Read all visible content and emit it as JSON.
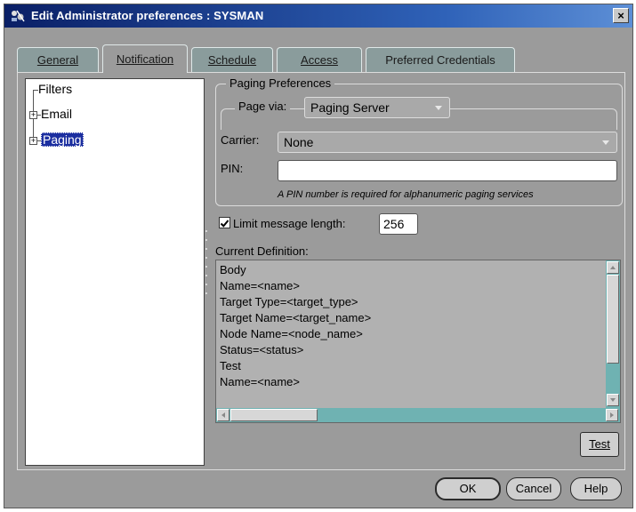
{
  "window": {
    "title": "Edit Administrator preferences : SYSMAN",
    "close_glyph": "×"
  },
  "tabs": [
    {
      "label": "General",
      "active": false
    },
    {
      "label": "Notification",
      "active": true
    },
    {
      "label": "Schedule",
      "active": false
    },
    {
      "label": "Access",
      "active": false
    },
    {
      "label": "Preferred Credentials",
      "active": false
    }
  ],
  "tree": {
    "items": [
      {
        "label": "Filters",
        "expandable": false,
        "selected": false
      },
      {
        "label": "Email",
        "expandable": true,
        "selected": false
      },
      {
        "label": "Paging",
        "expandable": true,
        "selected": true
      }
    ]
  },
  "paging": {
    "group_label": "Paging Preferences",
    "page_via_label": "Page via:",
    "page_via_value": "Paging Server",
    "carrier_label": "Carrier:",
    "carrier_value": "None",
    "pin_label": "PIN:",
    "pin_value": "",
    "pin_hint": "A PIN number is required for alphanumeric paging services"
  },
  "limit": {
    "label": "Limit message length:",
    "checked": true,
    "value": "256"
  },
  "definition": {
    "label": "Current Definition:",
    "lines": [
      "Body",
      " Name=<name>",
      " Target Type=<target_type>",
      " Target Name=<target_name>",
      " Node Name=<node_name>",
      " Status=<status>",
      "Test",
      " Name=<name>"
    ]
  },
  "buttons": {
    "test": "Test",
    "ok": "OK",
    "cancel": "Cancel",
    "help": "Help"
  },
  "colors": {
    "title_bar": "#0a1f66",
    "selection": "#1c2fa0",
    "scrollbar": "#6fb2b2",
    "background": "#9b9b9b"
  }
}
